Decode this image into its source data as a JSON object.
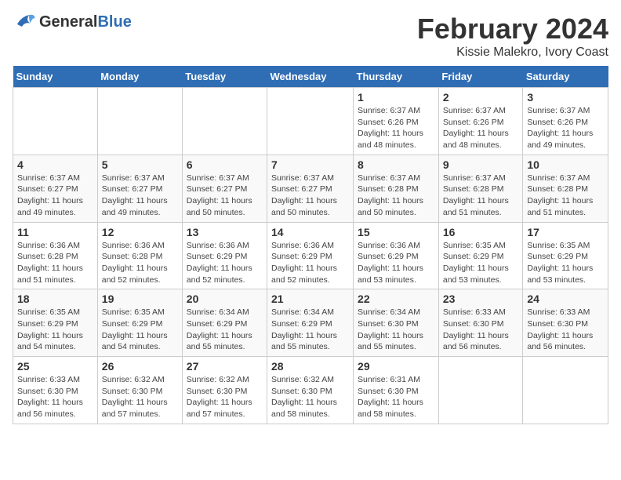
{
  "logo": {
    "text_general": "General",
    "text_blue": "Blue"
  },
  "title": "February 2024",
  "subtitle": "Kissie Malekro, Ivory Coast",
  "days_of_week": [
    "Sunday",
    "Monday",
    "Tuesday",
    "Wednesday",
    "Thursday",
    "Friday",
    "Saturday"
  ],
  "weeks": [
    [
      {
        "day": "",
        "info": ""
      },
      {
        "day": "",
        "info": ""
      },
      {
        "day": "",
        "info": ""
      },
      {
        "day": "",
        "info": ""
      },
      {
        "day": "1",
        "info": "Sunrise: 6:37 AM\nSunset: 6:26 PM\nDaylight: 11 hours\nand 48 minutes."
      },
      {
        "day": "2",
        "info": "Sunrise: 6:37 AM\nSunset: 6:26 PM\nDaylight: 11 hours\nand 48 minutes."
      },
      {
        "day": "3",
        "info": "Sunrise: 6:37 AM\nSunset: 6:26 PM\nDaylight: 11 hours\nand 49 minutes."
      }
    ],
    [
      {
        "day": "4",
        "info": "Sunrise: 6:37 AM\nSunset: 6:27 PM\nDaylight: 11 hours\nand 49 minutes."
      },
      {
        "day": "5",
        "info": "Sunrise: 6:37 AM\nSunset: 6:27 PM\nDaylight: 11 hours\nand 49 minutes."
      },
      {
        "day": "6",
        "info": "Sunrise: 6:37 AM\nSunset: 6:27 PM\nDaylight: 11 hours\nand 50 minutes."
      },
      {
        "day": "7",
        "info": "Sunrise: 6:37 AM\nSunset: 6:27 PM\nDaylight: 11 hours\nand 50 minutes."
      },
      {
        "day": "8",
        "info": "Sunrise: 6:37 AM\nSunset: 6:28 PM\nDaylight: 11 hours\nand 50 minutes."
      },
      {
        "day": "9",
        "info": "Sunrise: 6:37 AM\nSunset: 6:28 PM\nDaylight: 11 hours\nand 51 minutes."
      },
      {
        "day": "10",
        "info": "Sunrise: 6:37 AM\nSunset: 6:28 PM\nDaylight: 11 hours\nand 51 minutes."
      }
    ],
    [
      {
        "day": "11",
        "info": "Sunrise: 6:36 AM\nSunset: 6:28 PM\nDaylight: 11 hours\nand 51 minutes."
      },
      {
        "day": "12",
        "info": "Sunrise: 6:36 AM\nSunset: 6:28 PM\nDaylight: 11 hours\nand 52 minutes."
      },
      {
        "day": "13",
        "info": "Sunrise: 6:36 AM\nSunset: 6:29 PM\nDaylight: 11 hours\nand 52 minutes."
      },
      {
        "day": "14",
        "info": "Sunrise: 6:36 AM\nSunset: 6:29 PM\nDaylight: 11 hours\nand 52 minutes."
      },
      {
        "day": "15",
        "info": "Sunrise: 6:36 AM\nSunset: 6:29 PM\nDaylight: 11 hours\nand 53 minutes."
      },
      {
        "day": "16",
        "info": "Sunrise: 6:35 AM\nSunset: 6:29 PM\nDaylight: 11 hours\nand 53 minutes."
      },
      {
        "day": "17",
        "info": "Sunrise: 6:35 AM\nSunset: 6:29 PM\nDaylight: 11 hours\nand 53 minutes."
      }
    ],
    [
      {
        "day": "18",
        "info": "Sunrise: 6:35 AM\nSunset: 6:29 PM\nDaylight: 11 hours\nand 54 minutes."
      },
      {
        "day": "19",
        "info": "Sunrise: 6:35 AM\nSunset: 6:29 PM\nDaylight: 11 hours\nand 54 minutes."
      },
      {
        "day": "20",
        "info": "Sunrise: 6:34 AM\nSunset: 6:29 PM\nDaylight: 11 hours\nand 55 minutes."
      },
      {
        "day": "21",
        "info": "Sunrise: 6:34 AM\nSunset: 6:29 PM\nDaylight: 11 hours\nand 55 minutes."
      },
      {
        "day": "22",
        "info": "Sunrise: 6:34 AM\nSunset: 6:30 PM\nDaylight: 11 hours\nand 55 minutes."
      },
      {
        "day": "23",
        "info": "Sunrise: 6:33 AM\nSunset: 6:30 PM\nDaylight: 11 hours\nand 56 minutes."
      },
      {
        "day": "24",
        "info": "Sunrise: 6:33 AM\nSunset: 6:30 PM\nDaylight: 11 hours\nand 56 minutes."
      }
    ],
    [
      {
        "day": "25",
        "info": "Sunrise: 6:33 AM\nSunset: 6:30 PM\nDaylight: 11 hours\nand 56 minutes."
      },
      {
        "day": "26",
        "info": "Sunrise: 6:32 AM\nSunset: 6:30 PM\nDaylight: 11 hours\nand 57 minutes."
      },
      {
        "day": "27",
        "info": "Sunrise: 6:32 AM\nSunset: 6:30 PM\nDaylight: 11 hours\nand 57 minutes."
      },
      {
        "day": "28",
        "info": "Sunrise: 6:32 AM\nSunset: 6:30 PM\nDaylight: 11 hours\nand 58 minutes."
      },
      {
        "day": "29",
        "info": "Sunrise: 6:31 AM\nSunset: 6:30 PM\nDaylight: 11 hours\nand 58 minutes."
      },
      {
        "day": "",
        "info": ""
      },
      {
        "day": "",
        "info": ""
      }
    ]
  ]
}
